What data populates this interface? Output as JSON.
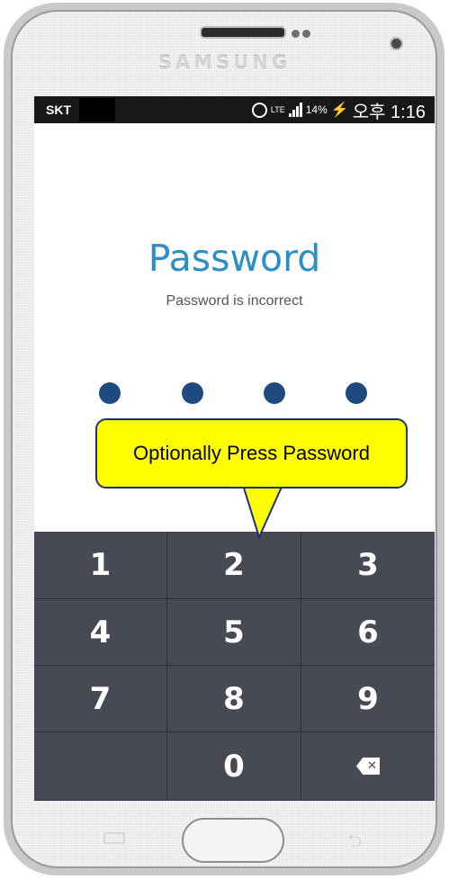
{
  "device": {
    "brand": "SAMSUNG"
  },
  "status_bar": {
    "carrier": "SKT",
    "network": "LTE",
    "battery": "14%",
    "time": "오후 1:16"
  },
  "lock_screen": {
    "title": "Password",
    "message": "Password is incorrect",
    "pin_dots_filled": 4
  },
  "callout": {
    "text": "Optionally Press Password",
    "fill_color": "#ffff00",
    "border_color": "#1f2d84"
  },
  "keypad": {
    "keys": [
      "1",
      "2",
      "3",
      "4",
      "5",
      "6",
      "7",
      "8",
      "9",
      "",
      "0",
      "⌫"
    ]
  },
  "colors": {
    "title": "#2b8fc6",
    "dot": "#1e4a80",
    "keypad_bg": "#474a55"
  },
  "icons": [
    "alarm-icon",
    "lte-icon",
    "signal-icon",
    "charging-icon",
    "backspace-icon",
    "menu-key-icon",
    "back-key-icon"
  ]
}
